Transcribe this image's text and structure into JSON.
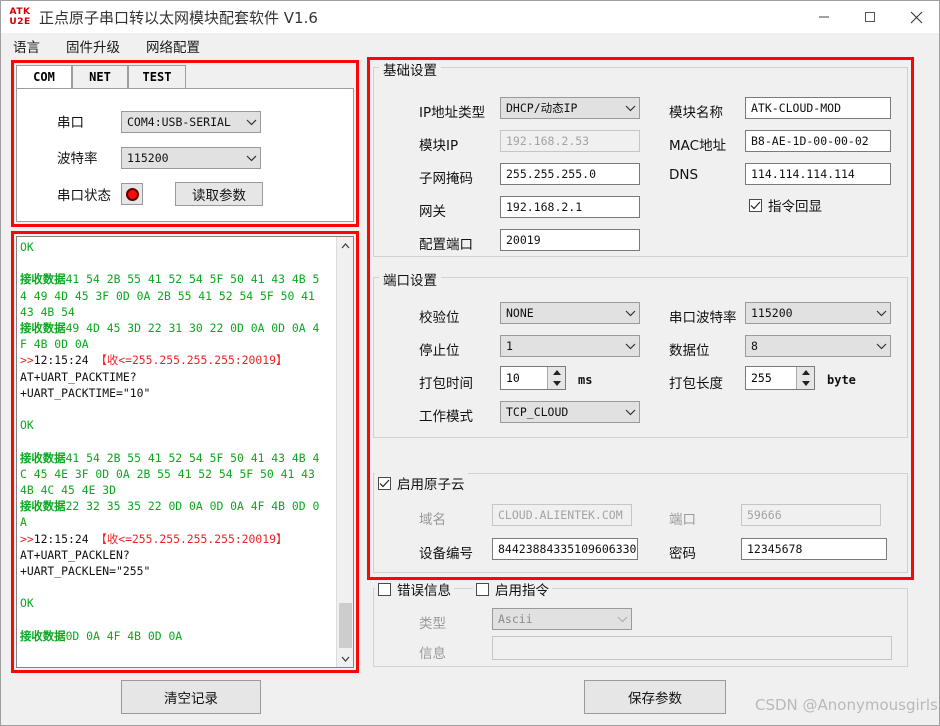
{
  "window": {
    "title": "正点原子串口转以太网模块配套软件 V1.6",
    "logo_top": "ATK",
    "logo_bottom": "U2E",
    "minimize": "minimize",
    "maximize": "maximize",
    "close": "close"
  },
  "menu": {
    "items": [
      {
        "label": "语言"
      },
      {
        "label": "固件升级"
      },
      {
        "label": "网络配置"
      }
    ]
  },
  "com_panel": {
    "tabs": [
      {
        "label": "COM",
        "selected": true
      },
      {
        "label": "NET",
        "selected": false
      },
      {
        "label": "TEST",
        "selected": false
      }
    ],
    "serial_port_label": "串口",
    "serial_port_value": "COM4:USB-SERIAL",
    "baud_label": "波特率",
    "baud_value": "115200",
    "status_label": "串口状态",
    "status_indicator": "red-led",
    "read_params_button": "读取参数"
  },
  "log": {
    "content_lines": [
      "OK",
      "",
      "接收数据41 54 2B 55 41 52 54 5F 50 41 43 4B 54 49 4D 45 3F 0D 0A 2B 55 41 52 54 5F 50 41 43 4B 54",
      "接收数据49 4D 45 3D 22 31 30 22 0D 0A 0D 0A 4F 4B 0D 0A",
      ">>12:15:24 【收<=255.255.255.255:20019】",
      "AT+UART_PACKTIME?",
      "+UART_PACKTIME=\"10\"",
      "",
      "OK",
      "",
      "接收数据41 54 2B 55 41 52 54 5F 50 41 43 4B 4C 45 4E 3F 0D 0A 2B 55 41 52 54 5F 50 41 43 4B 4C 45 4E 3D",
      "接收数据22 32 35 35 22 0D 0A 0D 0A 4F 4B 0D 0A",
      ">>12:15:24 【收<=255.255.255.255:20019】",
      "AT+UART_PACKLEN?",
      "+UART_PACKLEN=\"255\"",
      "",
      "OK",
      "",
      "接收数据0D 0A 4F 4B 0D 0A"
    ],
    "timestamp": "12:15:24",
    "peer": "255.255.255.255:20019",
    "clear_button": "清空记录"
  },
  "basic": {
    "title": "基础设置",
    "ip_type_label": "IP地址类型",
    "ip_type_value": "DHCP/动态IP",
    "module_ip_label": "模块IP",
    "module_ip_value": "192.168.2.53",
    "subnet_label": "子网掩码",
    "subnet_value": "255.255.255.0",
    "gateway_label": "网关",
    "gateway_value": "192.168.2.1",
    "config_port_label": "配置端口",
    "config_port_value": "20019",
    "module_name_label": "模块名称",
    "module_name_value": "ATK-CLOUD-MOD",
    "mac_label": "MAC地址",
    "mac_value": "B8-AE-1D-00-00-02",
    "dns_label": "DNS",
    "dns_value": "114.114.114.114",
    "echo_label": "指令回显",
    "echo_checked": true
  },
  "port": {
    "title": "端口设置",
    "parity_label": "校验位",
    "parity_value": "NONE",
    "stopbits_label": "停止位",
    "stopbits_value": "1",
    "packtime_label": "打包时间",
    "packtime_value": "10",
    "packtime_unit": "ms",
    "workmode_label": "工作模式",
    "workmode_value": "TCP_CLOUD",
    "baud_label": "串口波特率",
    "baud_value": "115200",
    "databits_label": "数据位",
    "databits_value": "8",
    "packlen_label": "打包长度",
    "packlen_value": "255",
    "packlen_unit": "byte"
  },
  "cloud": {
    "title": "启用原子云",
    "enabled": true,
    "domain_label": "域名",
    "domain_value": "CLOUD.ALIENTEK.COM",
    "port_label": "端口",
    "port_value": "59666",
    "device_id_label": "设备编号",
    "device_id_value": "84423884335109606330",
    "password_label": "密码",
    "password_value": "12345678"
  },
  "error": {
    "error_info_label": "错误信息",
    "error_info_checked": false,
    "enable_cmd_label": "启用指令",
    "enable_cmd_checked": false,
    "type_label": "类型",
    "type_value": "Ascii",
    "message_label": "信息",
    "message_value": ""
  },
  "footer": {
    "save_button": "保存参数",
    "watermark": "CSDN @Anonymousgirls"
  },
  "colors": {
    "highlight": "#fb0505",
    "log_text": "#0aa81e",
    "log_rx": "#ee2222",
    "led": "#fa0a0a"
  }
}
